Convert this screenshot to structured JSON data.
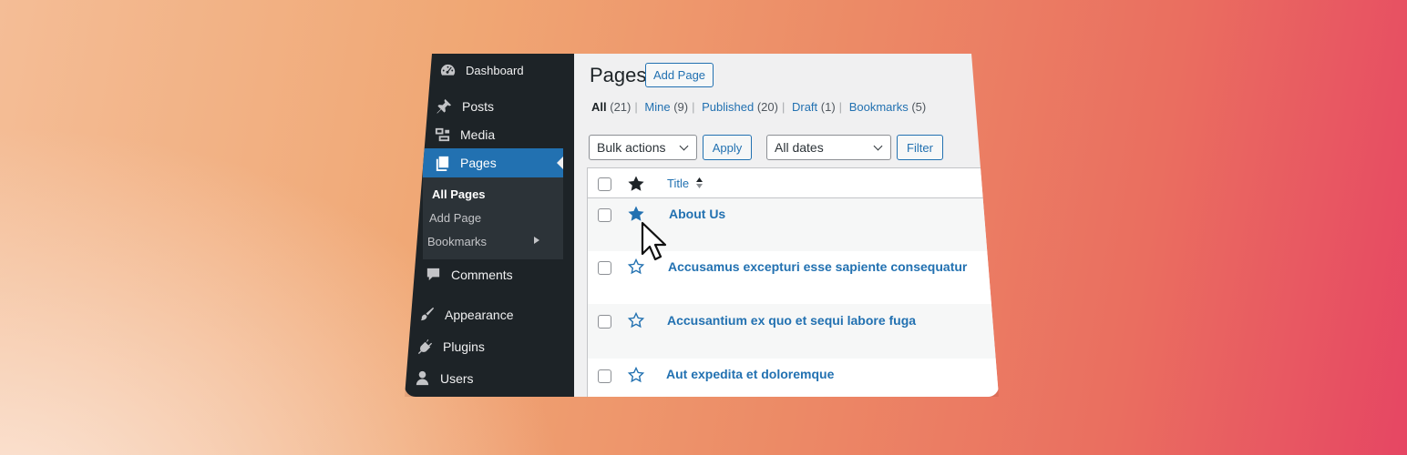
{
  "sidebar": {
    "items": [
      {
        "label": "Dashboard",
        "icon": "dashboard-icon"
      },
      {
        "label": "Posts",
        "icon": "pushpin-icon"
      },
      {
        "label": "Media",
        "icon": "media-icon"
      },
      {
        "label": "Pages",
        "icon": "pages-icon",
        "active": true
      },
      {
        "label": "Comments",
        "icon": "comment-icon"
      },
      {
        "label": "Appearance",
        "icon": "brush-icon"
      },
      {
        "label": "Plugins",
        "icon": "plugin-icon"
      },
      {
        "label": "Users",
        "icon": "user-icon"
      }
    ],
    "submenu": [
      {
        "label": "All Pages",
        "current": true
      },
      {
        "label": "Add Page"
      },
      {
        "label": "Bookmarks"
      }
    ]
  },
  "header": {
    "title": "Pages",
    "add_button": "Add Page"
  },
  "filters": [
    {
      "label": "All",
      "count": "(21)"
    },
    {
      "label": "Mine",
      "count": "(9)"
    },
    {
      "label": "Published",
      "count": "(20)"
    },
    {
      "label": "Draft",
      "count": "(1)"
    },
    {
      "label": "Bookmarks",
      "count": "(5)"
    }
  ],
  "toolbar": {
    "bulk_select": "Bulk actions",
    "apply": "Apply",
    "date_select": "All dates",
    "filter": "Filter"
  },
  "table": {
    "title_column": "Title",
    "rows": [
      {
        "title": "About Us",
        "bookmarked": true
      },
      {
        "title": "Accusamus excepturi esse sapiente consequatur",
        "bookmarked": false
      },
      {
        "title": "Accusantium ex quo et sequi labore fuga",
        "bookmarked": false
      },
      {
        "title": "Aut expedita et doloremque",
        "bookmarked": false
      }
    ]
  },
  "colors": {
    "sidebar_bg": "#1d2327",
    "accent": "#2271b1",
    "star_filled_header": "#1d2327",
    "star_filled_row": "#2271b1"
  }
}
